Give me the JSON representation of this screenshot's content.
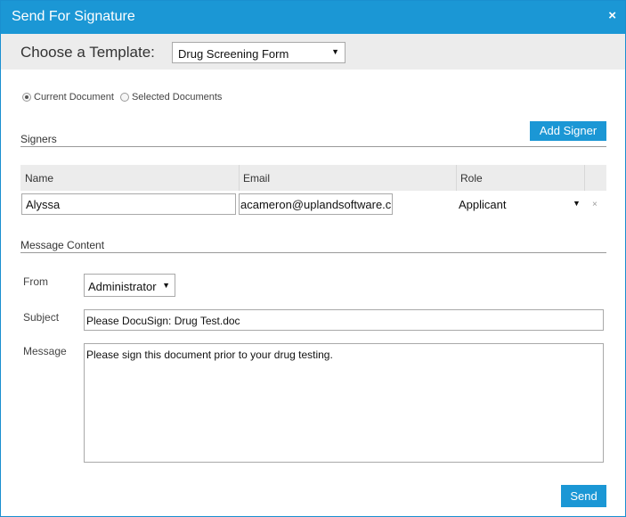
{
  "dialog": {
    "title": "Send For Signature",
    "close_label": "×"
  },
  "template": {
    "label": "Choose a Template:",
    "selected": "Drug Screening Form"
  },
  "scope": {
    "options": [
      {
        "label": "Current Document",
        "selected": true
      },
      {
        "label": "Selected Documents",
        "selected": false
      }
    ]
  },
  "signers": {
    "section_title": "Signers",
    "add_button": "Add Signer",
    "columns": [
      "Name",
      "Email",
      "Role"
    ],
    "rows": [
      {
        "name": "Alyssa",
        "email": "acameron@uplandsoftware.c",
        "role": "Applicant",
        "remove": "×"
      }
    ]
  },
  "message": {
    "section_title": "Message Content",
    "from_label": "From",
    "from_value": "Administrator",
    "subject_label": "Subject",
    "subject_value": "Please DocuSign: Drug Test.doc",
    "message_label": "Message",
    "message_value": "Please sign this document prior to your drug testing."
  },
  "actions": {
    "send_label": "Send"
  },
  "colors": {
    "accent": "#1b97d5",
    "header_bg": "#ececec"
  }
}
